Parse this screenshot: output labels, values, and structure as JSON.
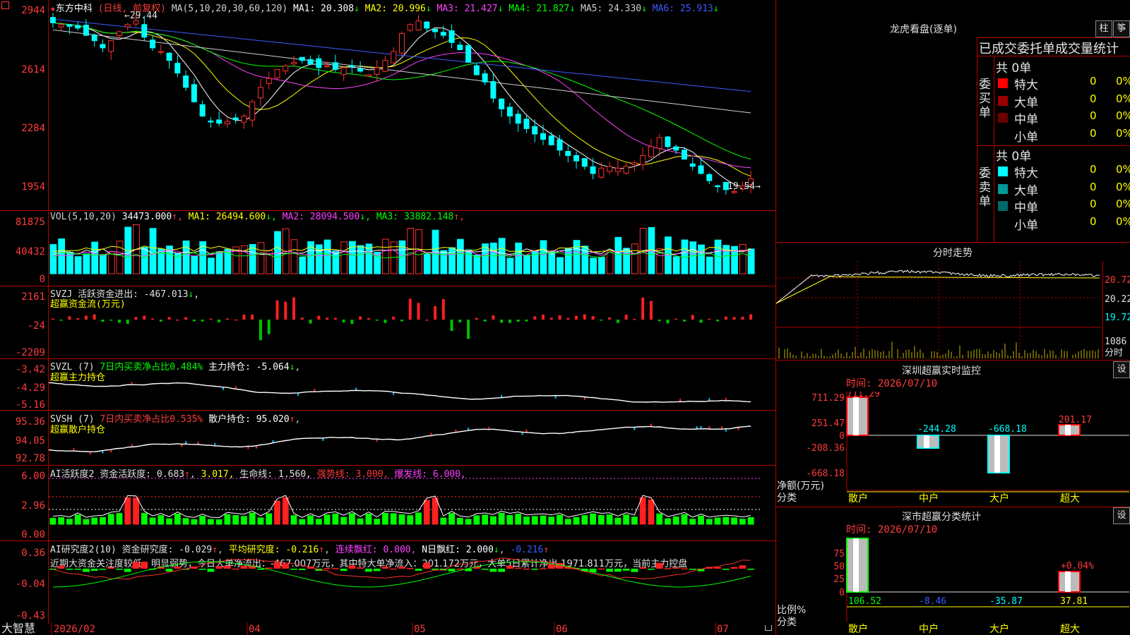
{
  "stock": {
    "name": "东方中科",
    "period": "(日线, 前复权)",
    "ma_line": [
      {
        "label": "MA(5,10,20,30,60,120)",
        "color": "#d0d0d0"
      },
      {
        "label": "MA1: 20.308",
        "color": "#ffffff"
      },
      {
        "label": "MA2: 20.996",
        "color": "#ffff00"
      },
      {
        "label": "MA3: 21.427",
        "color": "#ff40ff"
      },
      {
        "label": "MA4: 21.827",
        "color": "#00ff00"
      },
      {
        "label": "MA5: 24.330",
        "color": "#cfcfcf"
      },
      {
        "label": "MA6: 25.913",
        "color": "#3a5cff"
      }
    ],
    "high_label": "29.44",
    "low_label": "19.54",
    "yticks": [
      "2944",
      "2614",
      "2284",
      "1954"
    ]
  },
  "vol": {
    "header": [
      {
        "text": "VOL(5,10,20)",
        "color": "#d0d0d0"
      },
      {
        "text": "34473.000",
        "color": "#ffffff"
      },
      {
        "text": "MA1: 26494.600",
        "color": "#ffff00"
      },
      {
        "text": "MA2: 28094.500",
        "color": "#ff40ff"
      },
      {
        "text": "MA3: 33882.148",
        "color": "#00ff00"
      }
    ],
    "yticks": [
      "81875",
      "40432",
      "0"
    ]
  },
  "svzj": {
    "header": "SVZJ  活跃资金进出: -467.013",
    "sub": "超赢资金流(万元)",
    "yticks": [
      "2161",
      "-24",
      "-2209"
    ]
  },
  "svzl": {
    "h1": "SVZL (7)",
    "h2": "7日内买卖净占比0.484%",
    "h3": "主力持仓: -5.064",
    "sub": "超赢主力持仓",
    "yticks": [
      "-3.42",
      "-4.29",
      "-5.16"
    ]
  },
  "svsh": {
    "h1": "SVSH (7)",
    "h2": "7日内买卖净占比0.535%",
    "h3": "散户持仓: 95.020",
    "sub": "超赢散户持仓",
    "yticks": [
      "95.36",
      "94.05",
      "92.78"
    ]
  },
  "ai1": {
    "h1": "AI活跃度2 资金活跃度: 0.683",
    "h2": "3.017,",
    "h3": "生命线: 1.560,",
    "h4": "强势线: 3.000,",
    "h5": "爆发线: 6.000,",
    "yticks": [
      "6.00",
      "2.96",
      "0.00"
    ]
  },
  "ai2": {
    "h1": "AI研究度2(10) 资金研究度: -0.029",
    "h2": "平均研究度: -0.216",
    "h3": "连续飘红: 0.000,",
    "h4": "N日飘红: 2.000",
    "h5": "-0.216",
    "commentary": "近期大资金关注度较低，明显弱势，今日大单净流出：-467.007万元，其中特大单净流入：201.172万元，大单5日累计净出-1971.811万元，当前主力控盘",
    "yticks": [
      "0.36",
      "-0.04",
      "-0.43"
    ]
  },
  "bottom": {
    "app": "大智慧",
    "months": [
      "2026/02",
      "04",
      "05",
      "06",
      "07"
    ]
  },
  "right": {
    "title": "龙虎看盘(逐单)",
    "btn_zhu": "柱",
    "btn_zhe": "筝",
    "subtitle": "已成交委托单成交量统计",
    "buy_label": "委买单",
    "sell_label": "委卖单",
    "buy_total": "共 0单",
    "sell_total": "共 0单",
    "rows": [
      "特大",
      "大单",
      "中单",
      "小单"
    ],
    "zero": "0",
    "pct": "0%",
    "buy_colors": [
      "#ff0000",
      "#9a0000",
      "#6a0000",
      "#000000"
    ],
    "sell_colors": [
      "#00ffff",
      "#009a9a",
      "#006a6a",
      "#000000"
    ],
    "intraday_title": "分时走势",
    "intraday_yticks": [
      "20.72",
      "20.22",
      "19.72"
    ],
    "intraday_vol": "1086",
    "intraday_unit": "分时",
    "monitor_title": "深圳超赢实时监控",
    "monitor_time": "时间: 2026/07/10",
    "monitor_yticks": [
      "711.29",
      "251.47",
      "0",
      "-208.36",
      "-668.18"
    ],
    "monitor_values": [
      "711.29",
      "-244.28",
      "-668.18",
      "201.17"
    ],
    "monitor_unit": "净额(万元)",
    "monitor_cat": "分类",
    "categories": [
      "散户",
      "中户",
      "大户",
      "超大"
    ],
    "stat_title": "深市超赢分类统计",
    "stat_time": "时间: 2026/07/10",
    "stat_yticks": [
      "75",
      "50",
      "25",
      "0"
    ],
    "stat_values": [
      "106.52",
      "-8.46",
      "-35.87",
      "37.81"
    ],
    "stat_badge": "+0.04%",
    "stat_unit": "比例%",
    "stat_cat": "分类",
    "btn_set": "设"
  }
}
